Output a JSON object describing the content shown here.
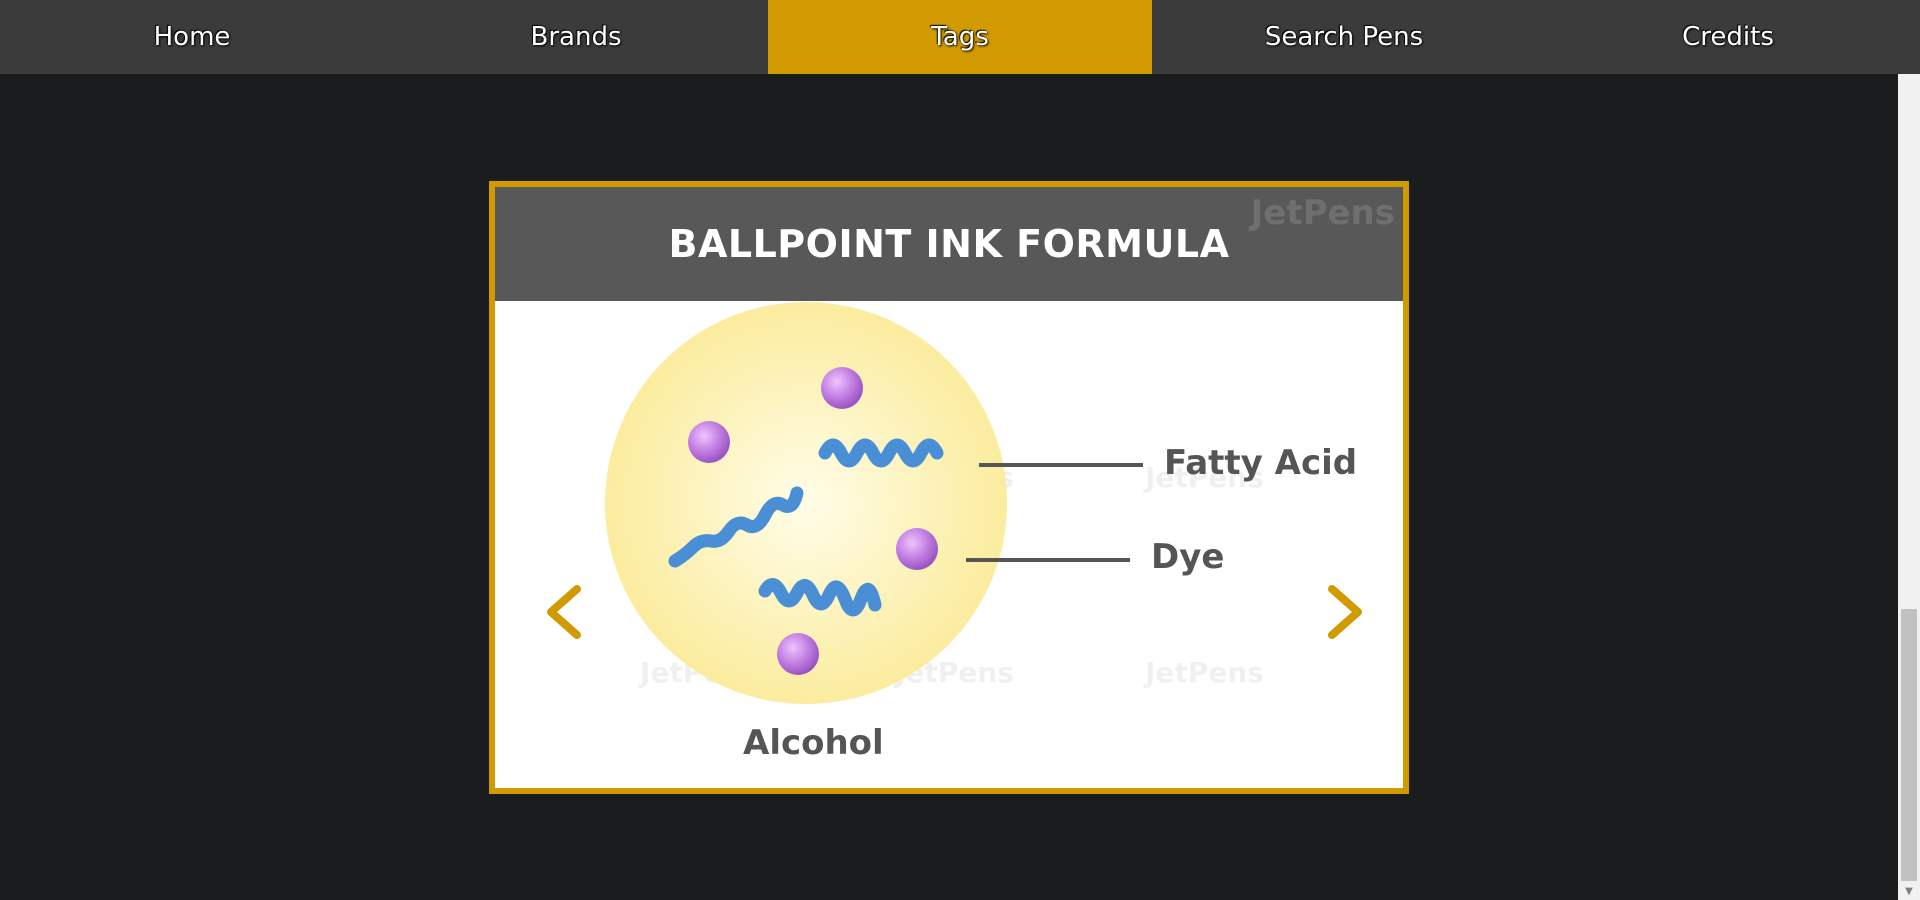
{
  "nav": {
    "items": [
      {
        "label": "Home"
      },
      {
        "label": "Brands"
      },
      {
        "label": "Tags"
      },
      {
        "label": "Search Pens"
      },
      {
        "label": "Credits"
      }
    ],
    "active_index": 2
  },
  "slide": {
    "title": "BALLPOINT INK FORMULA",
    "logo": "JetPens",
    "labels": {
      "fatty_acid": "Fatty Acid",
      "dye": "Dye",
      "alcohol": "Alcohol"
    },
    "prev_icon": "chevron-left-icon",
    "next_icon": "chevron-right-icon"
  },
  "colors": {
    "accent": "#d19a00",
    "nav_bg": "#3b3b3b",
    "page_bg": "#1b1c1e",
    "header_bg": "#585858",
    "dye": "#c07ce0",
    "fatty_acid": "#4a8fd6",
    "alcohol": "#fbeea0"
  }
}
